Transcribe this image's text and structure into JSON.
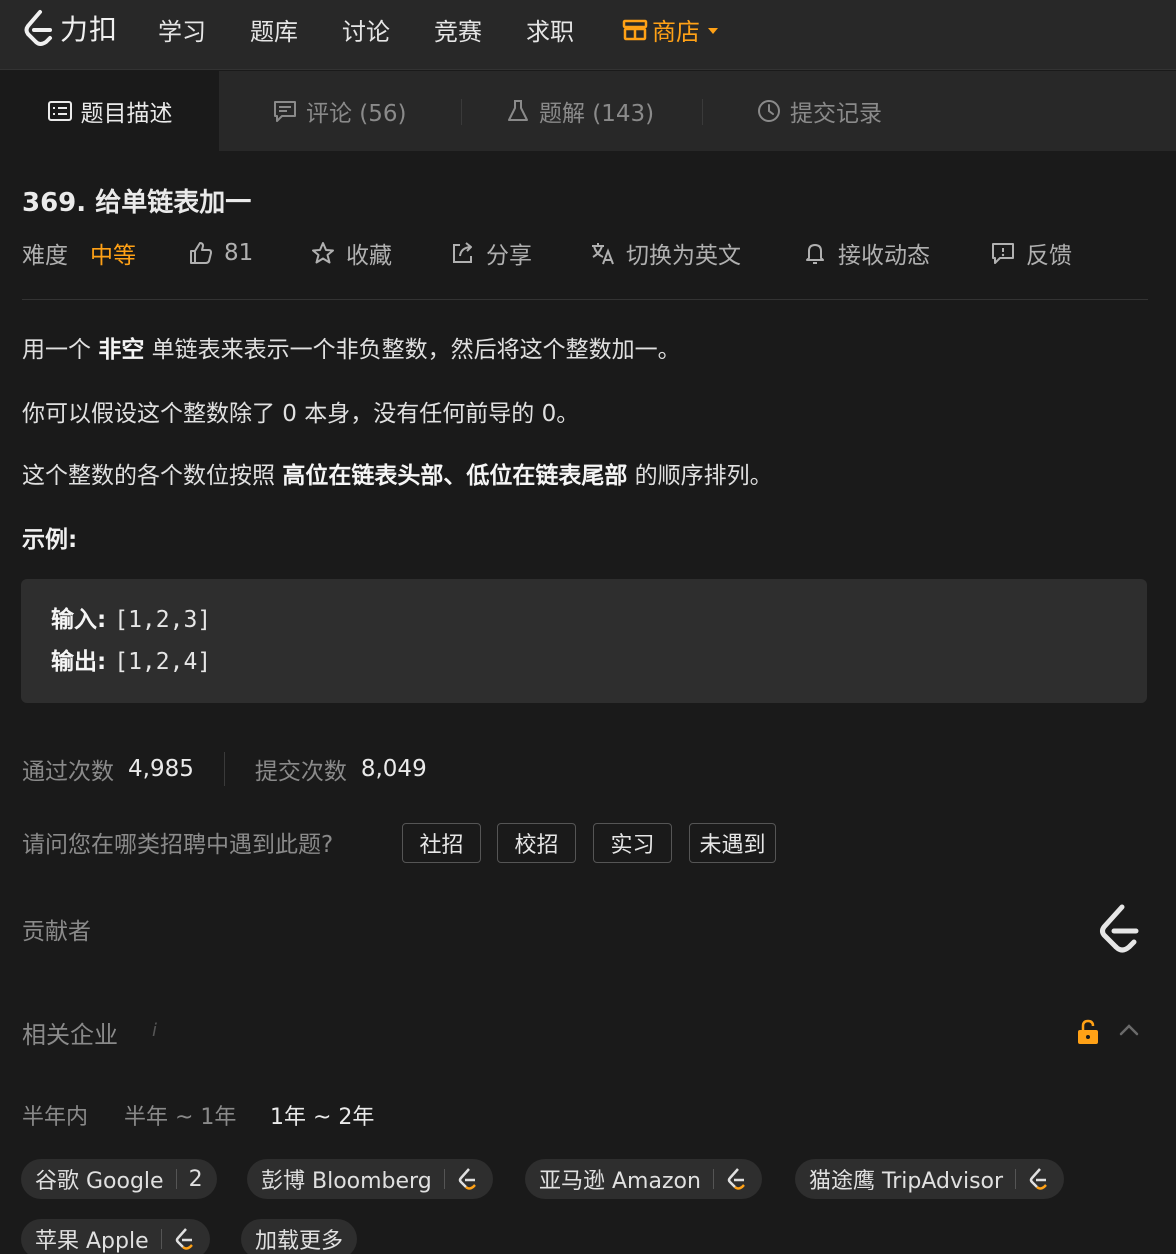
{
  "nav": {
    "logo_text": "力扣",
    "items": [
      "学习",
      "题库",
      "讨论",
      "竞赛",
      "求职"
    ],
    "store_label": "商店"
  },
  "tabs": {
    "description": "题目描述",
    "comments": "评论 (56)",
    "solutions": "题解 (143)",
    "submissions": "提交记录"
  },
  "problem": {
    "title": "369. 给单链表加一",
    "difficulty_label": "难度",
    "difficulty": "中等",
    "likes": "81",
    "favorite": "收藏",
    "share": "分享",
    "switch_lang": "切换为英文",
    "notify": "接收动态",
    "feedback": "反馈"
  },
  "description": {
    "p1_a": "用一个 ",
    "p1_b": "非空",
    "p1_c": " 单链表来表示一个非负整数，然后将这个整数加一。",
    "p2": "你可以假设这个整数除了 0 本身，没有任何前导的 0。",
    "p3_a": "这个整数的各个数位按照 ",
    "p3_b": "高位在链表头部、低位在链表尾部",
    "p3_c": " 的顺序排列。",
    "example_label": "示例:",
    "input_label": "输入: ",
    "input_value": "[1,2,3]",
    "output_label": "输出: ",
    "output_value": "[1,2,4]"
  },
  "stats": {
    "accepted_label": "通过次数",
    "accepted": "4,985",
    "submitted_label": "提交次数",
    "submitted": "8,049"
  },
  "survey": {
    "question": "请问您在哪类招聘中遇到此题?",
    "options": [
      "社招",
      "校招",
      "实习",
      "未遇到"
    ]
  },
  "contributors_label": "贡献者",
  "companies": {
    "label": "相关企业",
    "info": "i",
    "periods": [
      "半年内",
      "半年 ~ 1年",
      "1年 ~ 2年"
    ],
    "active_period": "1年 ~ 2年",
    "chips": [
      {
        "name": "谷歌 Google",
        "count": "2"
      },
      {
        "name": "彭博 Bloomberg"
      },
      {
        "name": "亚马逊 Amazon"
      },
      {
        "name": "猫途鹰 TripAdvisor"
      },
      {
        "name": "苹果 Apple"
      }
    ],
    "load_more": "加载更多"
  },
  "colors": {
    "accent": "#ffa116",
    "background": "#1a1a1a",
    "panel": "#282828"
  }
}
